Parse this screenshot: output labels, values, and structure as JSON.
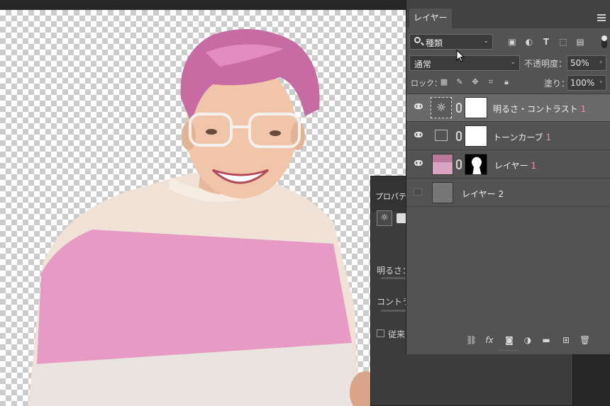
{
  "window": {
    "collapse_icon": "double-chevron-left-icon",
    "close_icon": "close-icon"
  },
  "layers_panel": {
    "tab_label": "レイヤー",
    "filter": {
      "value": "種類",
      "icons": [
        "image-filter-icon",
        "adjustment-filter-icon",
        "type-filter-icon",
        "shape-filter-icon",
        "smart-object-filter-icon"
      ]
    },
    "blend_mode": "通常",
    "opacity_label": "不透明度：",
    "opacity_value": "50%",
    "lock_label": "ロック：",
    "lock_icons": [
      "lock-transparent-icon",
      "lock-image-icon",
      "lock-position-icon",
      "lock-artboard-icon",
      "lock-all-icon"
    ],
    "fill_label": "塗り：",
    "fill_value": "100%",
    "layers": [
      {
        "name": "明るさ・コントラスト",
        "num": "1",
        "visible": true,
        "selected": true
      },
      {
        "name": "トーンカーブ",
        "num": "1",
        "visible": true,
        "selected": false
      },
      {
        "name": "レイヤー",
        "num": "1",
        "visible": true,
        "selected": false
      },
      {
        "name": "レイヤー 2",
        "num": "",
        "visible": false,
        "selected": false
      }
    ],
    "footer_icons": [
      "link-layers-icon",
      "fx-icon",
      "add-mask-icon",
      "new-adjustment-icon",
      "new-group-icon",
      "new-layer-icon",
      "trash-icon"
    ],
    "fx_label": "fx"
  },
  "properties_panel": {
    "tab_label": "プロパティ",
    "brightness_label": "明るさ：",
    "contrast_label": "コントラスト",
    "legacy_label": "従来"
  }
}
